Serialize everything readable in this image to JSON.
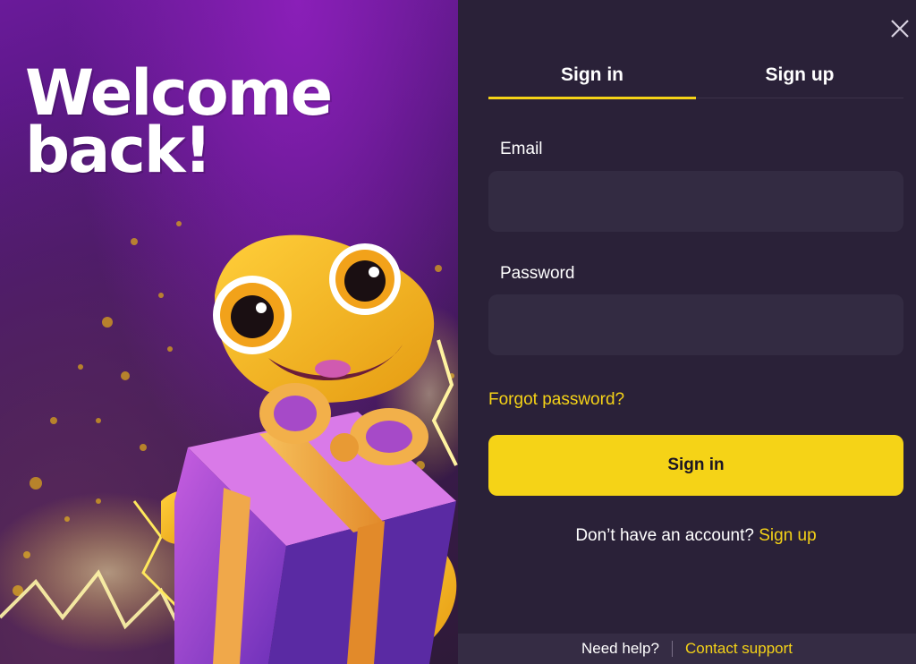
{
  "promo": {
    "headline_line1": "Welcome",
    "headline_line2": "back!"
  },
  "tabs": [
    {
      "label": "Sign in",
      "active": true
    },
    {
      "label": "Sign up",
      "active": false
    }
  ],
  "form": {
    "email_label": "Email",
    "email_value": "",
    "password_label": "Password",
    "password_value": "",
    "forgot_label": "Forgot password?",
    "submit_label": "Sign in",
    "no_account_text": "Don’t have an account?",
    "signup_link": "Sign up"
  },
  "footer": {
    "help_text": "Need help?",
    "support_link": "Contact support"
  },
  "colors": {
    "accent": "#f5d317",
    "panel_bg": "#2a2138",
    "input_bg": "#332b42",
    "promo_purple": "#6a1a9a"
  },
  "icons": {
    "close": "close-icon",
    "mascot": "lizard-mascot-with-gift"
  }
}
